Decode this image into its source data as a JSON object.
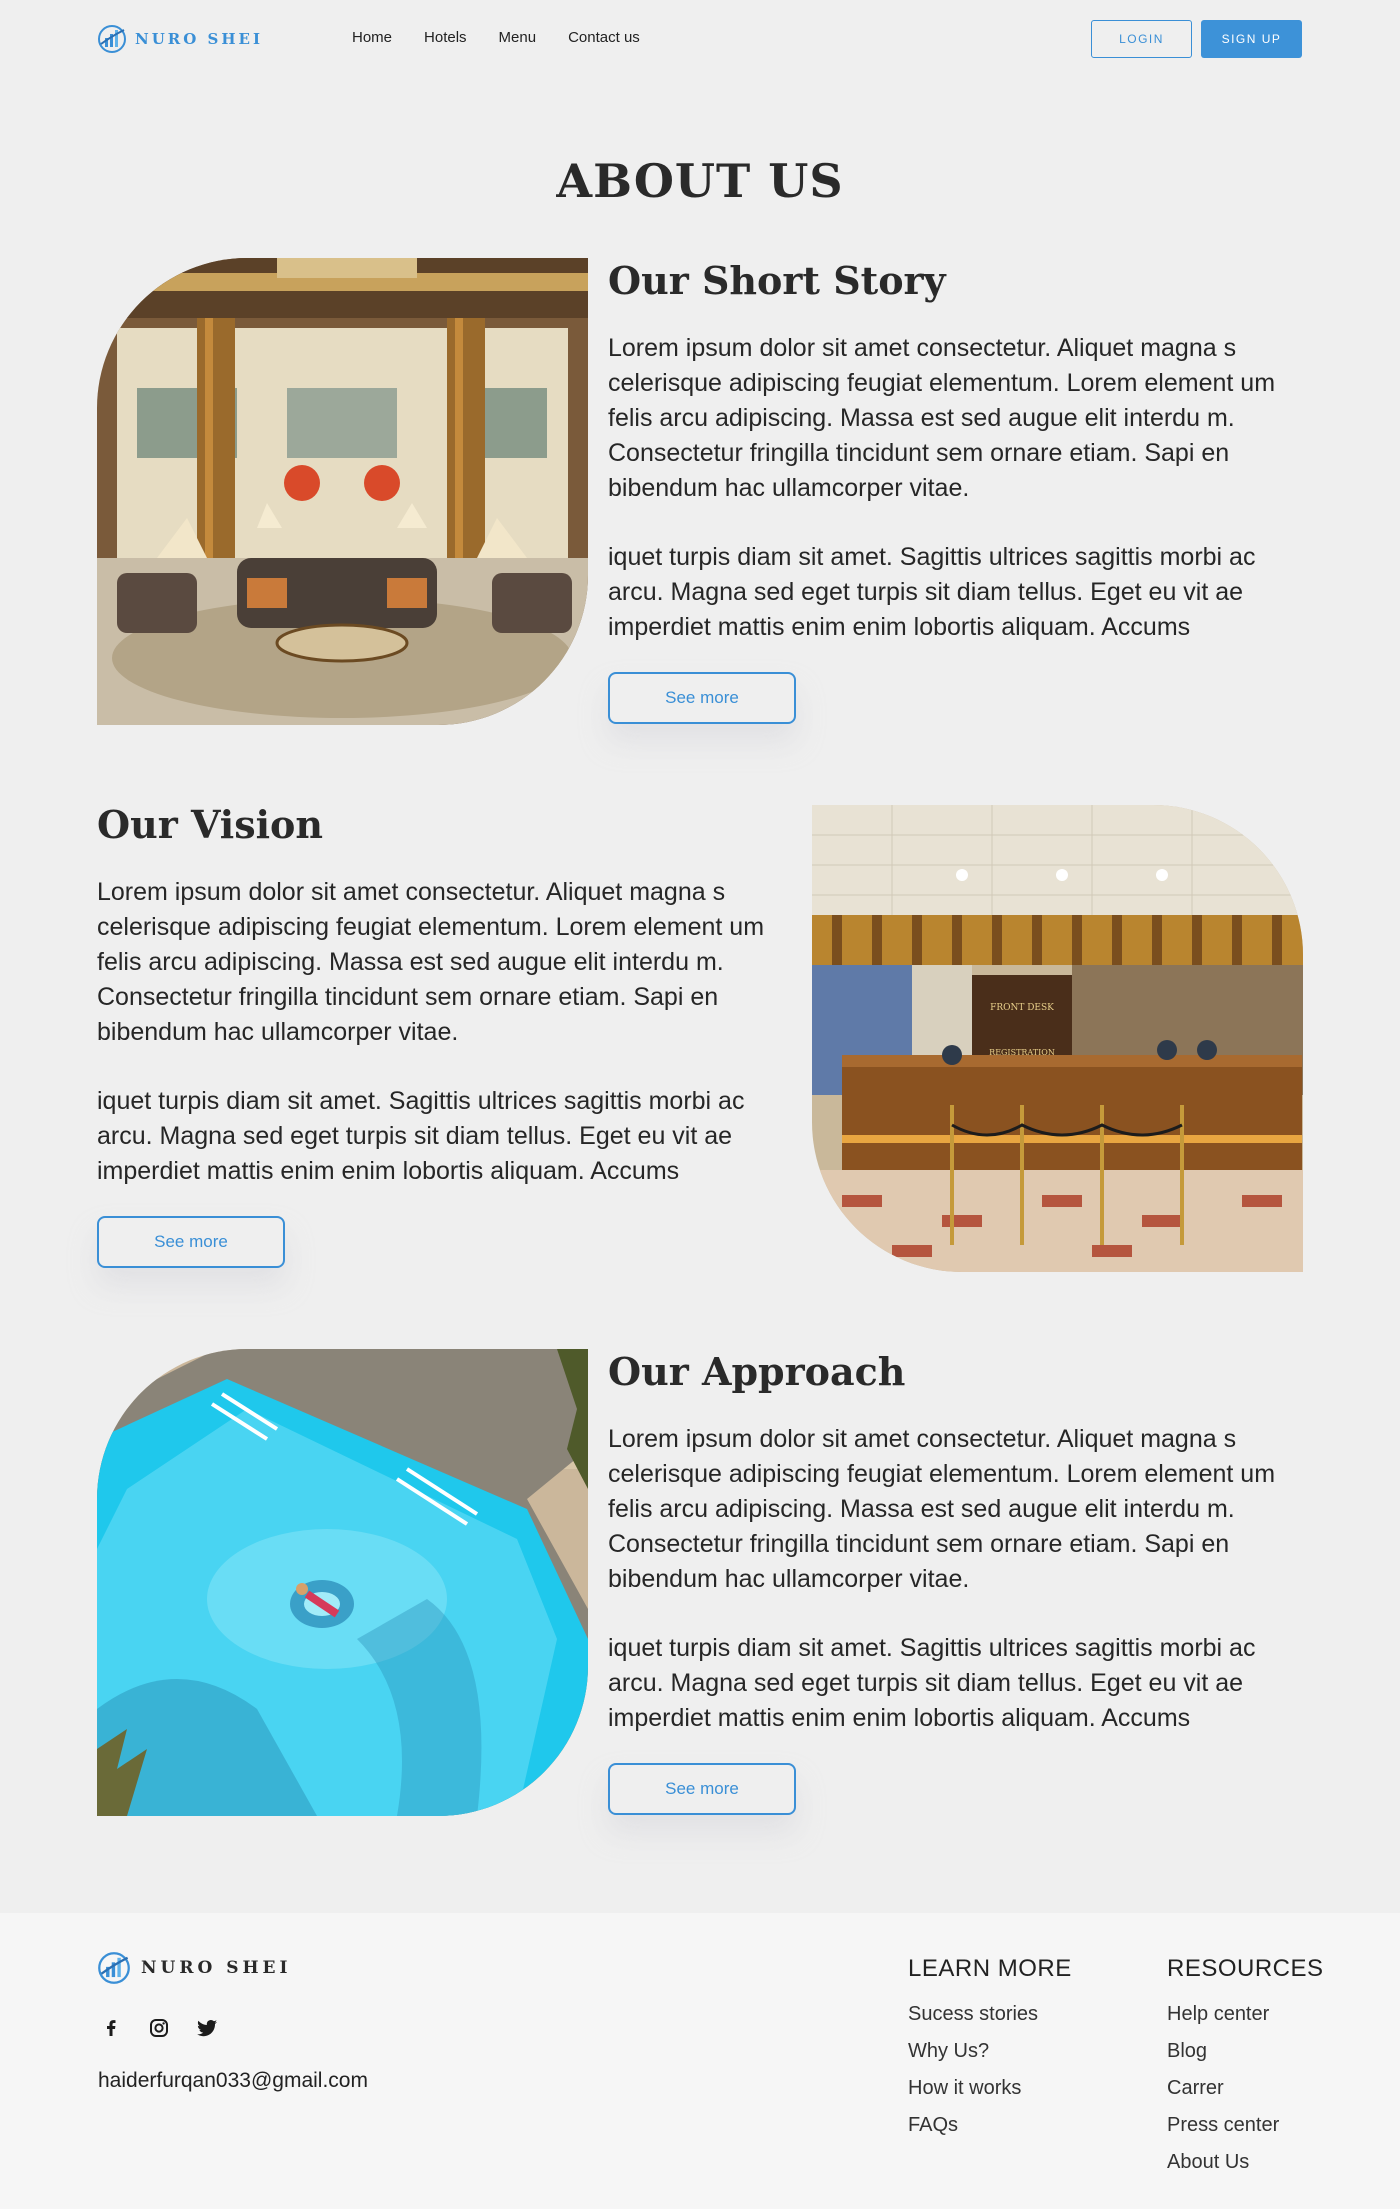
{
  "brand": {
    "name": "NURO SHEI",
    "accent": "#3a8fd6"
  },
  "nav": {
    "links": [
      "Home",
      "Hotels",
      "Menu",
      "Contact us"
    ],
    "login": "LOGIN",
    "signup": "SIGN UP"
  },
  "page_title": "ABOUT US",
  "sections": [
    {
      "heading": "Our Short Story",
      "p1": "Lorem ipsum dolor sit amet consectetur. Aliquet magna s celerisque adipiscing feugiat elementum. Lorem element um felis arcu adipiscing. Massa est sed augue elit interdu m. Consectetur fringilla tincidunt sem ornare etiam. Sapi en bibendum hac ullamcorper vitae.",
      "p2": "iquet turpis diam sit amet. Sagittis ultrices sagittis morbi ac arcu. Magna sed eget turpis sit diam tellus. Eget eu vit ae imperdiet mattis enim enim lobortis aliquam. Accums",
      "button": "See more",
      "image": "hotel-lobby"
    },
    {
      "heading": "Our Vision",
      "p1": "Lorem ipsum dolor sit amet consectetur. Aliquet magna s celerisque adipiscing feugiat elementum. Lorem element um felis arcu adipiscing. Massa est sed augue elit interdu m. Consectetur fringilla tincidunt sem ornare etiam. Sapi en bibendum hac ullamcorper vitae.",
      "p2": "iquet turpis diam sit amet. Sagittis ultrices sagittis morbi ac arcu. Magna sed eget turpis sit diam tellus. Eget eu vit ae imperdiet mattis enim enim lobortis aliquam. Accums",
      "button": "See more",
      "image": "front-desk",
      "image_signs": [
        "FRONT DESK",
        "REGISTRATION"
      ]
    },
    {
      "heading": "Our Approach",
      "p1": "Lorem ipsum dolor sit amet consectetur. Aliquet magna s celerisque adipiscing feugiat elementum. Lorem element um felis arcu adipiscing. Massa est sed augue elit interdu m. Consectetur fringilla tincidunt sem ornare etiam. Sapi en bibendum hac ullamcorper vitae.",
      "p2": "iquet turpis diam sit amet. Sagittis ultrices sagittis morbi ac arcu. Magna sed eget turpis sit diam tellus. Eget eu vit ae imperdiet mattis enim enim lobortis aliquam. Accums",
      "button": "See more",
      "image": "swimming-pool"
    }
  ],
  "footer": {
    "brand": "NURO SHEI",
    "socials": [
      "facebook-icon",
      "instagram-icon",
      "twitter-icon"
    ],
    "email": "haiderfurqan033@gmail.com",
    "learn_more": {
      "title": "LEARN MORE",
      "links": [
        "Sucess stories",
        "Why Us?",
        "How it works",
        "FAQs"
      ]
    },
    "resources": {
      "title": "RESOURCES",
      "links": [
        "Help center",
        "Blog",
        "Carrer",
        "Press center",
        "About Us"
      ]
    }
  }
}
